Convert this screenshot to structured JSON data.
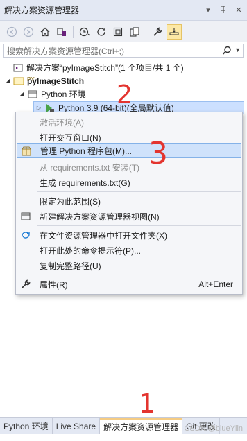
{
  "window": {
    "title": "解决方案资源管理器",
    "controls": [
      "chevron-down-icon",
      "pin-icon",
      "close-icon"
    ]
  },
  "toolbar": {
    "buttons": [
      "back-arrow-icon",
      "forward-arrow-icon",
      "home-icon",
      "switch-views-icon",
      "history-icon",
      "refresh-icon",
      "collapse-all-icon",
      "show-all-files-icon",
      "properties-wrench-icon",
      "preview-icon"
    ]
  },
  "search": {
    "placeholder": "搜索解决方案资源管理器(Ctrl+;)"
  },
  "tree": {
    "solution": "解决方案“pyImageStitch”(1 个项目/共 1 个)",
    "project_badge": "PY",
    "project": "pyImageStitch",
    "python_env": "Python 环境",
    "interpreter": "Python 3.9 (64-bit)(全局默认值)"
  },
  "context_menu": {
    "items": [
      {
        "label": "激活环境(A)",
        "disabled": true
      },
      {
        "label": "打开交互窗口(N)"
      },
      {
        "label": "管理 Python 程序包(M)...",
        "icon": "package-icon",
        "hover": true
      },
      {
        "label": "从 requirements.txt 安装(T)",
        "disabled": true
      },
      {
        "label": "生成 requirements.txt(G)"
      },
      {
        "label": "限定为此范围(S)"
      },
      {
        "label": "新建解决方案资源管理器视图(N)",
        "icon": "new-view-icon"
      },
      {
        "label": "在文件资源管理器中打开文件夹(X)",
        "icon": "sync-arrow-icon"
      },
      {
        "label": "打开此处的命令提示符(P)..."
      },
      {
        "label": "复制完整路径(U)"
      },
      {
        "label": "属性(R)",
        "icon": "wrench-icon",
        "shortcut": "Alt+Enter"
      }
    ]
  },
  "annotations": {
    "one": "1",
    "two": "2",
    "three": "3"
  },
  "bottom_tabs": [
    {
      "label": "Python 环境"
    },
    {
      "label": "Live Share"
    },
    {
      "label": "解决方案资源管理器",
      "active": true
    },
    {
      "label": "Git 更改"
    }
  ],
  "watermark": "CSDN @blueYlin"
}
